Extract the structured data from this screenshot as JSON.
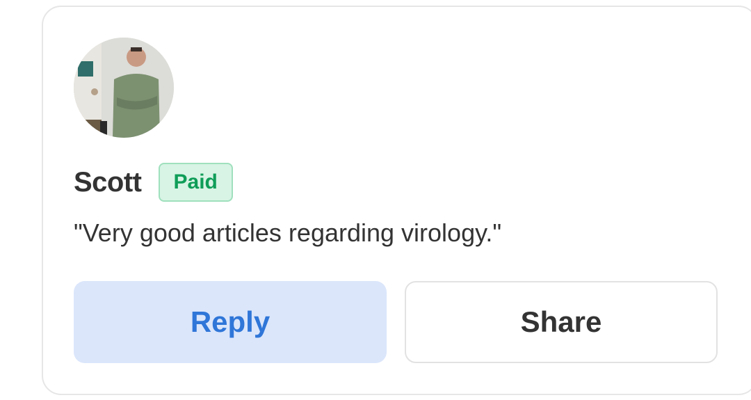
{
  "review": {
    "author": "Scott",
    "badge": "Paid",
    "comment": "\"Very good articles regarding virology.\""
  },
  "actions": {
    "reply_label": "Reply",
    "share_label": "Share"
  },
  "colors": {
    "badge_text": "#0f9d58",
    "badge_bg": "#d8f4e5",
    "reply_bg": "#dbe6fb",
    "reply_text": "#2f76d8"
  }
}
